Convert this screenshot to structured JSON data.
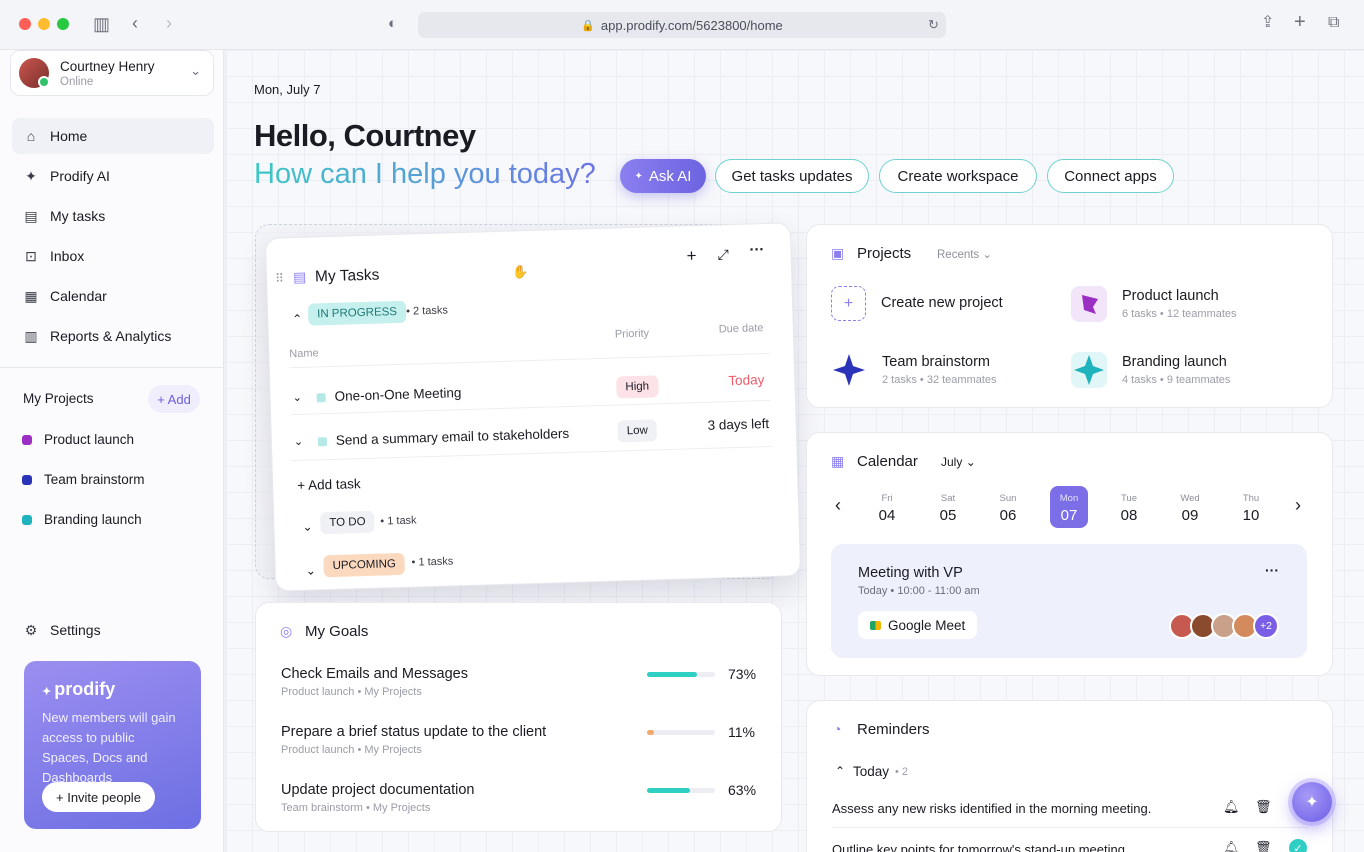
{
  "browser": {
    "url": "app.prodify.com/5623800/home"
  },
  "user": {
    "name": "Courtney Henry",
    "status": "Online"
  },
  "nav": [
    {
      "label": "Home",
      "icon": "home-icon"
    },
    {
      "label": "Prodify AI",
      "icon": "sparkle-icon"
    },
    {
      "label": "My tasks",
      "icon": "clipboard-icon"
    },
    {
      "label": "Inbox",
      "icon": "inbox-icon"
    },
    {
      "label": "Calendar",
      "icon": "calendar-icon"
    },
    {
      "label": "Reports & Analytics",
      "icon": "chart-icon"
    }
  ],
  "projects_nav": {
    "title": "My Projects",
    "add": "+ Add",
    "items": [
      {
        "label": "Product launch",
        "color": "#9b2fc4"
      },
      {
        "label": "Team brainstorm",
        "color": "#2b34b8"
      },
      {
        "label": "Branding launch",
        "color": "#1fb3bd"
      }
    ]
  },
  "settings": "Settings",
  "promo": {
    "brand": "prodify",
    "text": "New members will gain access to public Spaces, Docs and Dashboards",
    "button": "+ Invite people"
  },
  "header": {
    "date": "Mon, July 7",
    "greeting": "Hello, Courtney",
    "question": "How can I help you today?",
    "ask_ai": "Ask AI",
    "actions": [
      "Get tasks updates",
      "Create workspace",
      "Connect apps"
    ]
  },
  "tasks": {
    "title": "My Tasks",
    "in_progress": "IN PROGRESS",
    "in_progress_count": "2 tasks",
    "col_name": "Name",
    "col_priority": "Priority",
    "col_due": "Due date",
    "rows": [
      {
        "name": "One-on-One Meeting",
        "priority": "High",
        "due": "Today"
      },
      {
        "name": "Send a summary email to stakeholders",
        "priority": "Low",
        "due": "3 days left"
      }
    ],
    "add_task": "+ Add task",
    "todo": "TO DO",
    "todo_count": "1 task",
    "upcoming": "UPCOMING",
    "upcoming_count": "1 tasks"
  },
  "goals": {
    "title": "My Goals",
    "items": [
      {
        "name": "Check Emails and Messages",
        "project": "Product launch",
        "space": "My Projects",
        "progress": 73,
        "label": "73%",
        "color": "#2fcfc4"
      },
      {
        "name": "Prepare a brief status update to the client",
        "project": "Product launch",
        "space": "My Projects",
        "progress": 11,
        "label": "11%",
        "color": "#f4a86a"
      },
      {
        "name": "Update project documentation",
        "project": "Team brainstorm",
        "space": "My Projects",
        "progress": 63,
        "label": "63%",
        "color": "#2fcfc4"
      }
    ]
  },
  "projects": {
    "title": "Projects",
    "filter": "Recents",
    "create": "Create new project",
    "items": [
      {
        "name": "Product launch",
        "tasks": "6 tasks",
        "team": "12 teammates"
      },
      {
        "name": "Team brainstorm",
        "tasks": "2 tasks",
        "team": "32 teammates"
      },
      {
        "name": "Branding launch",
        "tasks": "4 tasks",
        "team": "9 teammates"
      }
    ]
  },
  "calendar": {
    "title": "Calendar",
    "month": "July",
    "days": [
      {
        "w": "Fri",
        "d": "04"
      },
      {
        "w": "Sat",
        "d": "05"
      },
      {
        "w": "Sun",
        "d": "06"
      },
      {
        "w": "Mon",
        "d": "07"
      },
      {
        "w": "Tue",
        "d": "08"
      },
      {
        "w": "Wed",
        "d": "09"
      },
      {
        "w": "Thu",
        "d": "10"
      }
    ],
    "event": {
      "title": "Meeting with VP",
      "day": "Today",
      "time": "10:00 - 11:00 am",
      "app": "Google Meet",
      "more": "+2"
    }
  },
  "reminders": {
    "title": "Reminders",
    "group": "Today",
    "count": "2",
    "items": [
      "Assess any new risks identified in the morning meeting.",
      "Outline key points for tomorrow's stand-up meeting"
    ]
  }
}
